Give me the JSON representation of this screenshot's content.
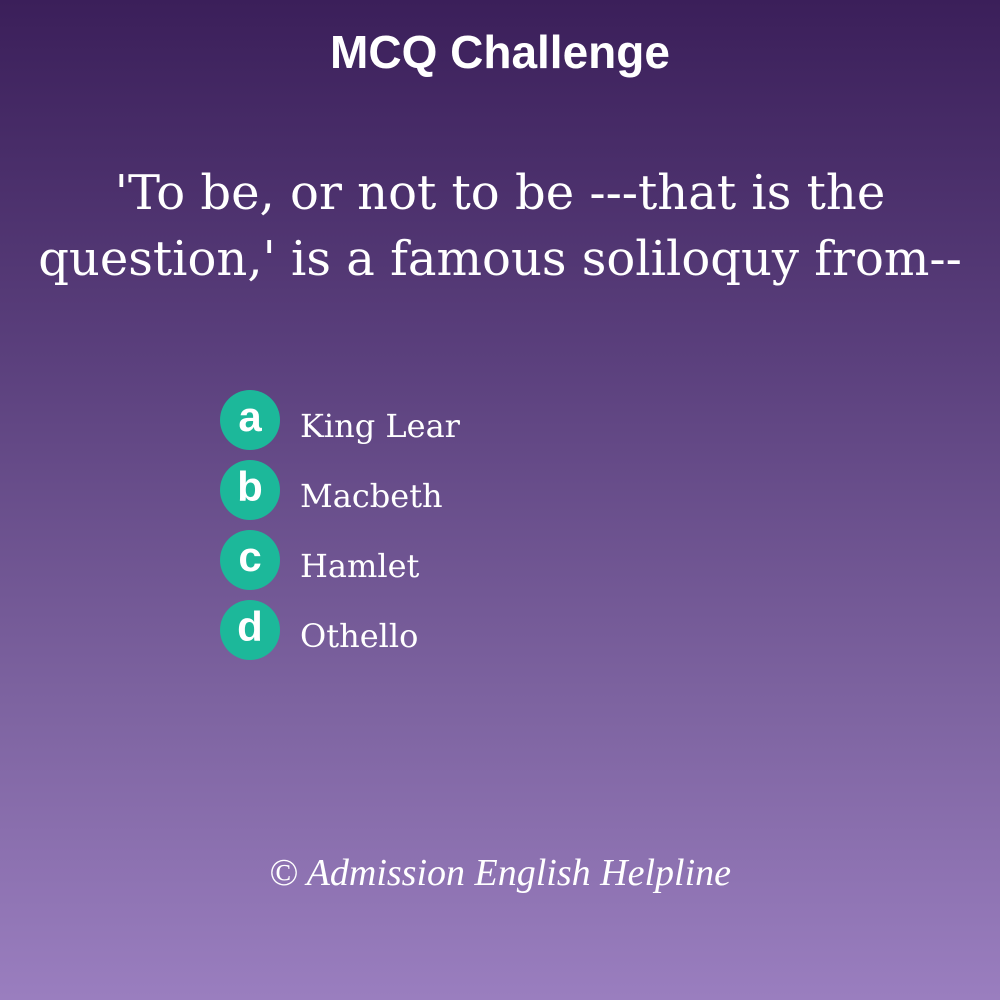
{
  "header": {
    "title": "MCQ Challenge"
  },
  "question": {
    "line1": "'To be, or not to be ---that is the",
    "line2": "question,' is a famous soliloquy from--"
  },
  "options": [
    {
      "letter": "a",
      "text": "King Lear"
    },
    {
      "letter": "b",
      "text": "Macbeth"
    },
    {
      "letter": "c",
      "text": "Hamlet"
    },
    {
      "letter": "d",
      "text": "Othello"
    }
  ],
  "footer": {
    "credit": "© Admission English Helpline"
  },
  "colors": {
    "badge": "#1cb89a",
    "background_top": "#3b1f5a",
    "background_bottom": "#9a7ebf",
    "text": "#ffffff"
  }
}
